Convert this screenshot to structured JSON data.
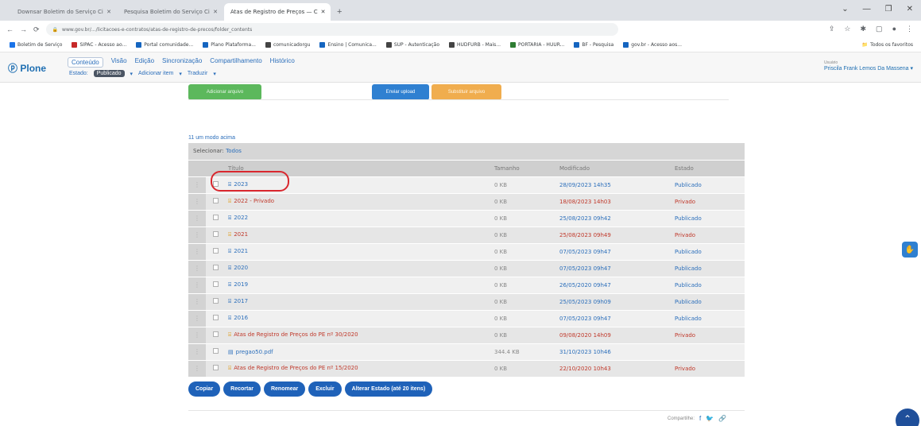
{
  "browser": {
    "tabs": [
      {
        "label": "Downsar Boletim do Serviço Ci",
        "active": false
      },
      {
        "label": "Pesquisa Boletim do Serviço Ci",
        "active": false
      },
      {
        "label": "Atas de Registro de Preços — C",
        "active": true
      }
    ],
    "new_tab": "+",
    "window_controls": [
      "⌄",
      "—",
      "❐",
      "✕"
    ],
    "url": "www.gov.br/.../licitacoes-e-contratos/atas-de-registro-de-precos/folder_contents",
    "bookmarks": [
      {
        "label": "Boletim de Serviço",
        "color": "#1a73e8"
      },
      {
        "label": "SIPAC - Acesso ao...",
        "color": "#c62828"
      },
      {
        "label": "Portal comunidade...",
        "color": "#1565c0"
      },
      {
        "label": "Plano Plataforma...",
        "color": "#1565c0"
      },
      {
        "label": "comunicadorgu",
        "color": "#444444"
      },
      {
        "label": "Ensino | Comunica...",
        "color": "#1565c0"
      },
      {
        "label": "SUP - Autenticação",
        "color": "#444444"
      },
      {
        "label": "HUDFURB - Mais...",
        "color": "#444444"
      },
      {
        "label": "PORTARIA - HUUR...",
        "color": "#2e7d32"
      },
      {
        "label": "BF - Pesquisa",
        "color": "#1565c0"
      },
      {
        "label": "gov.br - Acesso aos...",
        "color": "#1565c0"
      }
    ],
    "other_bookmarks": "Todos os favoritos"
  },
  "plone": {
    "logo": "Plone",
    "menu": [
      "Conteúdo",
      "Visão",
      "Edição",
      "Sincronização",
      "Compartilhamento",
      "Histórico"
    ],
    "active_menu": "Conteúdo",
    "submenu": {
      "state_label": "Estado:",
      "state_value": "Publicado",
      "add_item": "Adicionar item",
      "translate": "Traduzir"
    },
    "user_label": "Usuário",
    "user_name": "Priscila Frank Lemos Da Massena"
  },
  "top_buttons": {
    "green": "Adicionar arquivo",
    "blue": "Enviar upload",
    "orange": "Substituir arquivo"
  },
  "listing": {
    "count_text": "11 um modo acima",
    "select_label": "Selecionar:",
    "select_all": "Todos",
    "columns": [
      "Título",
      "Tamanho",
      "Modificado",
      "Estado"
    ],
    "rows": [
      {
        "title": "2023",
        "icon": "folder",
        "size": "0 KB",
        "modified": "28/09/2023 14h35",
        "state": "Publicado",
        "private": false
      },
      {
        "title": "2022 - Privado",
        "icon": "folder",
        "size": "0 KB",
        "modified": "18/08/2023 14h03",
        "state": "Privado",
        "private": true
      },
      {
        "title": "2022",
        "icon": "folder",
        "size": "0 KB",
        "modified": "25/08/2023 09h42",
        "state": "Publicado",
        "private": false
      },
      {
        "title": "2021",
        "icon": "folder",
        "size": "0 KB",
        "modified": "25/08/2023 09h49",
        "state": "Privado",
        "private": true
      },
      {
        "title": "2021",
        "icon": "folder",
        "size": "0 KB",
        "modified": "07/05/2023 09h47",
        "state": "Publicado",
        "private": false
      },
      {
        "title": "2020",
        "icon": "folder",
        "size": "0 KB",
        "modified": "07/05/2023 09h47",
        "state": "Publicado",
        "private": false
      },
      {
        "title": "2019",
        "icon": "folder",
        "size": "0 KB",
        "modified": "26/05/2020 09h47",
        "state": "Publicado",
        "private": false
      },
      {
        "title": "2017",
        "icon": "folder",
        "size": "0 KB",
        "modified": "25/05/2023 09h09",
        "state": "Publicado",
        "private": false
      },
      {
        "title": "2016",
        "icon": "folder",
        "size": "0 KB",
        "modified": "07/05/2023 09h47",
        "state": "Publicado",
        "private": false
      },
      {
        "title": "Atas de Registro de Preços do PE nº 30/2020",
        "icon": "folder",
        "size": "0 KB",
        "modified": "09/08/2020 14h09",
        "state": "Privado",
        "private": true
      },
      {
        "title": "pregao50.pdf",
        "icon": "file",
        "size": "344.4 KB",
        "modified": "31/10/2023 10h46",
        "state": "",
        "private": false
      },
      {
        "title": "Atas de Registro de Preços do PE nº 15/2020",
        "icon": "folder",
        "size": "0 KB",
        "modified": "22/10/2020 10h43",
        "state": "Privado",
        "private": true
      }
    ]
  },
  "bulk_actions": [
    "Copiar",
    "Recortar",
    "Renomear",
    "Excluir",
    "Alterar Estado (até 20 itens)"
  ],
  "share_label": "Compartilhe:",
  "colors": {
    "plone_blue": "#2c6fbb",
    "private_red": "#c0392b",
    "action_blue": "#1f62b9",
    "highlight_red": "#d9272e"
  }
}
